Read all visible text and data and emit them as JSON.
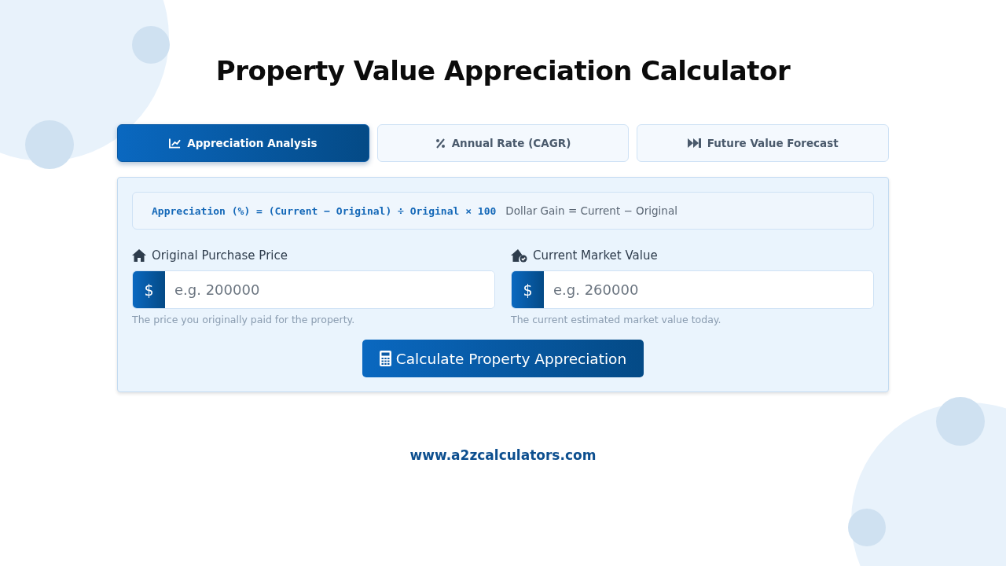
{
  "title": "Property Value Appreciation Calculator",
  "tabs": [
    {
      "label": "Appreciation Analysis",
      "selected": true
    },
    {
      "label": "Annual Rate (CAGR)",
      "selected": false
    },
    {
      "label": "Future Value Forecast",
      "selected": false
    }
  ],
  "formula": {
    "expression": "Appreciation (%) = (Current − Original) ÷ Original × 100",
    "note": "Dollar Gain = Current − Original"
  },
  "fields": [
    {
      "label": "Original Purchase Price",
      "prefix": "$",
      "placeholder": "e.g. 200000",
      "hint": "The price you originally paid for the property."
    },
    {
      "label": "Current Market Value",
      "prefix": "$",
      "placeholder": "e.g. 260000",
      "hint": "The current estimated market value today."
    }
  ],
  "button": {
    "label": "Calculate Property Appreciation"
  },
  "footer": {
    "link": "www.a2zcalculators.com"
  }
}
